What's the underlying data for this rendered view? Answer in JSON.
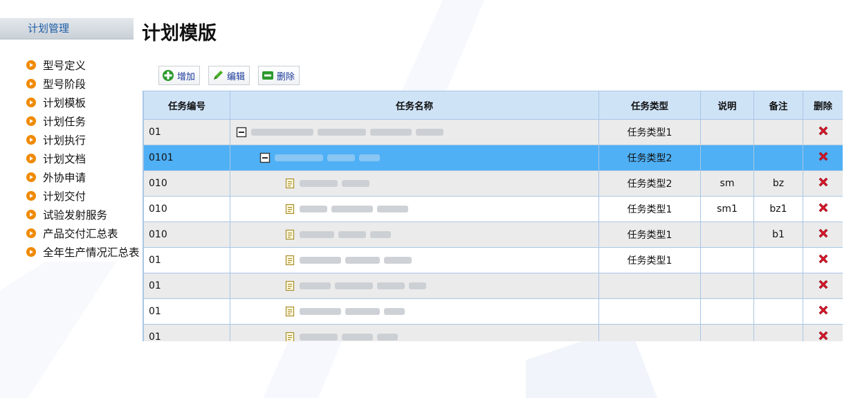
{
  "sidebar": {
    "title": "计划管理",
    "items": [
      {
        "label": "型号定义"
      },
      {
        "label": "型号阶段"
      },
      {
        "label": "计划模板"
      },
      {
        "label": "计划任务"
      },
      {
        "label": "计划执行"
      },
      {
        "label": "计划文档"
      },
      {
        "label": "外协申请"
      },
      {
        "label": "计划交付"
      },
      {
        "label": "试验发射服务"
      },
      {
        "label": "产品交付汇总表"
      },
      {
        "label": "全年生产情况汇总表"
      }
    ]
  },
  "page": {
    "title": "计划模版"
  },
  "toolbar": {
    "add_label": "增加",
    "edit_label": "编辑",
    "delete_label": "删除"
  },
  "table": {
    "headers": [
      "任务编号",
      "任务名称",
      "任务类型",
      "说明",
      "备注",
      "删除"
    ],
    "rows": [
      {
        "id": "01",
        "name": "",
        "level": 0,
        "node": "folder",
        "type": "任务类型1",
        "desc": "",
        "note": "",
        "selected": false
      },
      {
        "id": "0101",
        "name": "",
        "level": 1,
        "node": "folder",
        "type": "任务类型2",
        "desc": "",
        "note": "",
        "selected": true
      },
      {
        "id": "010",
        "name": "",
        "level": 2,
        "node": "doc",
        "type": "任务类型2",
        "desc": "sm",
        "note": "bz",
        "selected": false
      },
      {
        "id": "010",
        "name": "",
        "level": 2,
        "node": "doc",
        "type": "任务类型1",
        "desc": "sm1",
        "note": "bz1",
        "selected": false
      },
      {
        "id": "010",
        "name": "",
        "level": 2,
        "node": "doc",
        "type": "任务类型1",
        "desc": "",
        "note": "b1",
        "selected": false
      },
      {
        "id": "01",
        "name": "",
        "level": 2,
        "node": "doc",
        "type": "任务类型1",
        "desc": "",
        "note": "",
        "selected": false
      },
      {
        "id": "01",
        "name": "",
        "level": 2,
        "node": "doc",
        "type": "",
        "desc": "",
        "note": "",
        "selected": false
      },
      {
        "id": "01",
        "name": "",
        "level": 2,
        "node": "doc",
        "type": "",
        "desc": "",
        "note": "",
        "selected": false
      },
      {
        "id": "01",
        "name": "",
        "level": 2,
        "node": "doc",
        "type": "",
        "desc": "",
        "note": "",
        "selected": false
      }
    ]
  },
  "colors": {
    "accent_orange": "#f08a00",
    "header_blue": "#cfe3f7",
    "selected_row": "#4fb0f5",
    "delete_red": "#d9162a",
    "add_green": "#2c9a2c"
  }
}
